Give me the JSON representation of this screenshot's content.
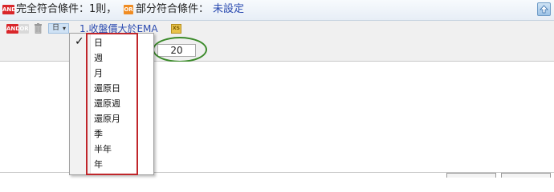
{
  "header": {
    "and_badge": "AND",
    "full_match_label": "完全符合條件：1則，",
    "or_badge": "OR",
    "partial_match_label": "部分符合條件：",
    "partial_match_value": "未設定"
  },
  "condition_row": {
    "and_badge": "AND",
    "or_badge": "OR",
    "period_value": "日",
    "condition_label": "1.收盤價大於EMA",
    "xs_icon": "XS",
    "parameter_value": "20"
  },
  "period_menu": {
    "items": [
      {
        "label": "日",
        "checked": true
      },
      {
        "label": "週",
        "checked": false
      },
      {
        "label": "月",
        "checked": false
      },
      {
        "label": "還原日",
        "checked": false
      },
      {
        "label": "還原週",
        "checked": false
      },
      {
        "label": "還原月",
        "checked": false
      },
      {
        "label": "季",
        "checked": false
      },
      {
        "label": "半年",
        "checked": false
      },
      {
        "label": "年",
        "checked": false
      }
    ],
    "check_mark": "✓"
  },
  "colors": {
    "label_blue": "#2a4ab0",
    "highlight_red": "#c0262b",
    "highlight_green": "#3b8a2a",
    "and_red": "#d9262a",
    "or_orange": "#f08c22"
  }
}
